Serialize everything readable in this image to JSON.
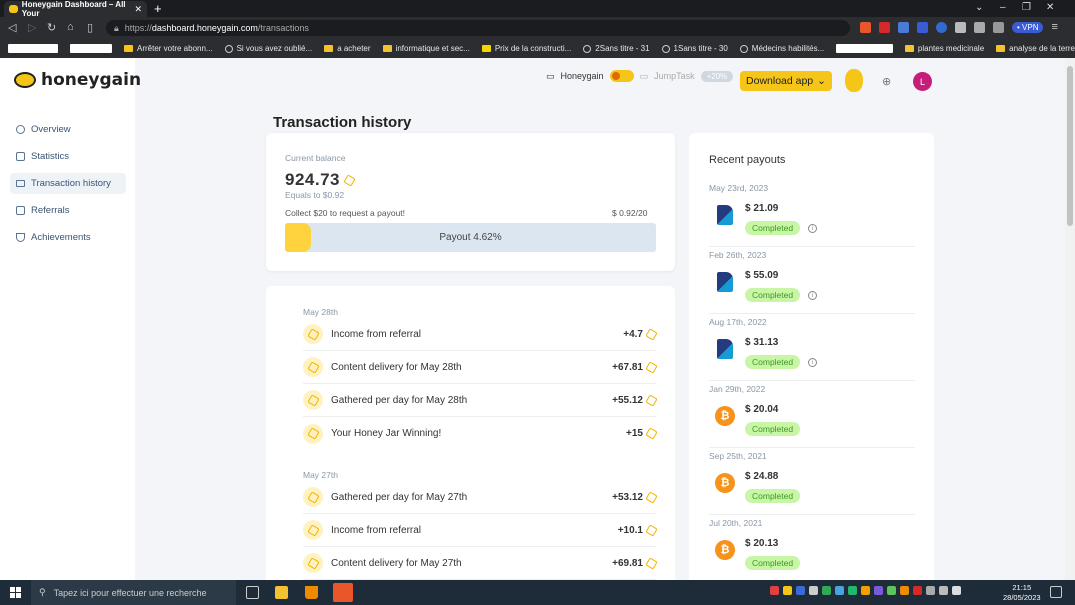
{
  "browser": {
    "tab_title": "Honeygain Dashboard – All Your",
    "url_host": "dashboard.honeygain.com",
    "url_path": "/transactions",
    "url_scheme": "https://",
    "vpn_label": "• VPN",
    "bookmarks": [
      "Arrêter votre abonn...",
      "Si vous avez oublié...",
      "a acheter",
      "informatique et sec...",
      "Prix de la constructi...",
      "2Sans titre - 31",
      "1Sans titre - 30",
      "Médecins habilités...",
      "plantes medicinale",
      "analyse de la terre"
    ]
  },
  "brand": {
    "name": "honeygain",
    "accent": "#f5c518"
  },
  "sidebar": {
    "items": [
      {
        "label": "Overview",
        "icon": "hexagon-icon"
      },
      {
        "label": "Statistics",
        "icon": "bar-chart-icon"
      },
      {
        "label": "Transaction history",
        "icon": "card-icon",
        "active": true
      },
      {
        "label": "Referrals",
        "icon": "users-icon"
      },
      {
        "label": "Achievements",
        "icon": "trophy-icon"
      }
    ]
  },
  "header": {
    "honeygain_label": "Honeygain",
    "jumptask_label": "JumpTask",
    "jumptask_badge": "+20%",
    "download_label": "Download app",
    "avatar_initial": "L"
  },
  "page_title": "Transaction history",
  "balance": {
    "label": "Current balance",
    "value": "924.73",
    "equals": "Equals to $0.92",
    "collect_text": "Collect $20 to request a payout!",
    "progress_text": "$ 0.92/20",
    "bar_label": "Payout 4.62%",
    "progress_fraction": 0.0462
  },
  "transactions": [
    {
      "date": "May 28th",
      "rows": [
        {
          "label": "Income from referral",
          "amount": "+4.7",
          "icon": "referral-icon"
        },
        {
          "label": "Content delivery for May 28th",
          "amount": "+67.81",
          "icon": "hexagon-icon"
        },
        {
          "label": "Gathered per day for May 28th",
          "amount": "+55.12",
          "icon": "hexagon-icon"
        },
        {
          "label": "Your Honey Jar Winning!",
          "amount": "+15",
          "icon": "hexagon-icon"
        }
      ]
    },
    {
      "date": "May 27th",
      "rows": [
        {
          "label": "Gathered per day for May 27th",
          "amount": "+53.12",
          "icon": "hexagon-icon"
        },
        {
          "label": "Income from referral",
          "amount": "+10.1",
          "icon": "referral-icon"
        },
        {
          "label": "Content delivery for May 27th",
          "amount": "+69.81",
          "icon": "hexagon-icon"
        }
      ]
    }
  ],
  "payouts": {
    "title": "Recent payouts",
    "items": [
      {
        "date": "May 23rd, 2023",
        "amount": "$ 21.09",
        "status": "Completed",
        "method": "paypal",
        "info": true
      },
      {
        "date": "Feb 26th, 2023",
        "amount": "$ 55.09",
        "status": "Completed",
        "method": "paypal",
        "info": true
      },
      {
        "date": "Aug 17th, 2022",
        "amount": "$ 31.13",
        "status": "Completed",
        "method": "paypal",
        "info": true
      },
      {
        "date": "Jan 29th, 2022",
        "amount": "$ 20.04",
        "status": "Completed",
        "method": "bitcoin",
        "info": false
      },
      {
        "date": "Sep 25th, 2021",
        "amount": "$ 24.88",
        "status": "Completed",
        "method": "bitcoin",
        "info": false
      },
      {
        "date": "Jul 20th, 2021",
        "amount": "$ 20.13",
        "status": "Completed",
        "method": "bitcoin",
        "info": false
      }
    ]
  },
  "taskbar": {
    "search_placeholder": "Tapez ici pour effectuer une recherche",
    "time": "21:15",
    "date": "28/05/2023"
  }
}
